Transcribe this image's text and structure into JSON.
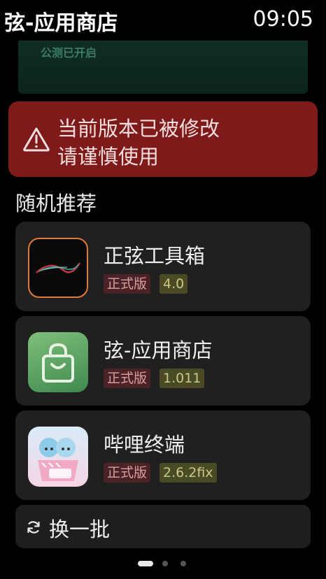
{
  "status_bar": {
    "app_title": "弦-应用商店",
    "time": "09:05"
  },
  "banner": {
    "text": "公测已开启"
  },
  "warning": {
    "line1": "当前版本已被修改",
    "line2": "请谨慎使用",
    "icon": "warning-triangle-icon",
    "color": "#7e1a1a"
  },
  "section": {
    "title": "随机推荐"
  },
  "apps": [
    {
      "name": "正弦工具箱",
      "release_tag": "正式版",
      "version": "4.0",
      "icon": "sine-toolbox-icon"
    },
    {
      "name": "弦-应用商店",
      "release_tag": "正式版",
      "version": "1.011",
      "icon": "store-bag-icon"
    },
    {
      "name": "哔哩终端",
      "release_tag": "正式版",
      "version": "2.6.2fix",
      "icon": "bilibili-terminal-icon"
    }
  ],
  "refresh": {
    "label": "换一批",
    "icon": "refresh-icon"
  },
  "pagination": {
    "total": 3,
    "current": 1
  }
}
